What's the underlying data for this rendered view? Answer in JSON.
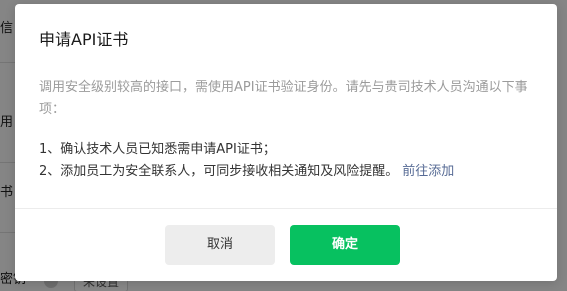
{
  "background": {
    "fragments": [
      "信",
      "用",
      "书",
      "密钥"
    ],
    "pill_label": "未设置"
  },
  "dialog": {
    "title": "申请API证书",
    "description": "调用安全级别较高的接口，需使用API证书验证身份。请先与贵司技术人员沟通以下事项：",
    "items": [
      {
        "text": "1、确认技术人员已知悉需申请API证书；"
      },
      {
        "text": "2、添加员工为安全联系人，可同步接收相关通知及风险提醒。",
        "link": "前往添加"
      }
    ],
    "buttons": {
      "cancel": "取消",
      "confirm": "确定"
    }
  },
  "colors": {
    "primary": "#07c160",
    "link": "#576b95",
    "cancel_bg": "#ededed"
  }
}
